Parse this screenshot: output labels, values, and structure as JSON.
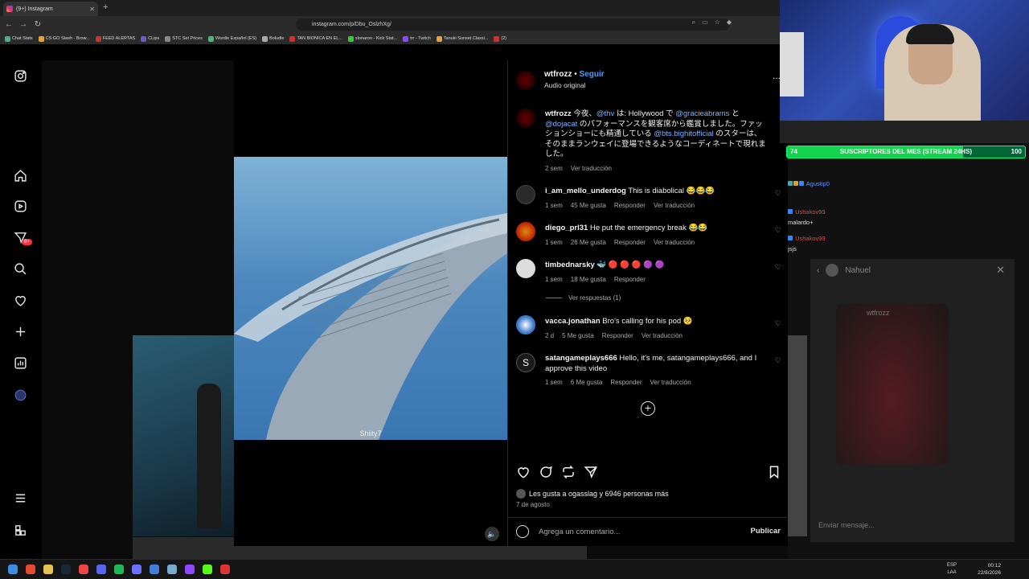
{
  "browser": {
    "tab_title": "(9+) Instagram",
    "url": "instagram.com/p/Dbu_OslzhXg/",
    "bookmarks": [
      "Chat Stats",
      "CS:GO Stash - Brow...",
      "FEED ALERTAS",
      "CLips",
      "STC Set Prices",
      "Wordle Español (ES)",
      "Boludle",
      "TAN BIONICA EN EL...",
      "slonaron - Kick Stat...",
      "trr - Twitch",
      "Tanuki Sunset Classi...",
      "(2)"
    ]
  },
  "sidebar": {
    "icons": [
      "instagram-icon",
      "home-icon",
      "reels-icon",
      "messages-icon",
      "search-icon",
      "heart-icon",
      "create-icon",
      "stats-icon",
      "profile-icon",
      "menu-icon",
      "grid-icon"
    ],
    "badge": "9+"
  },
  "post": {
    "username": "wtfrozz",
    "separator": "•",
    "follow": "Seguir",
    "audio": "Audio original",
    "more": "...",
    "media_label": "Shiity7",
    "caption": {
      "username": "wtfrozz",
      "p1": "今夜、",
      "m1": "@thv",
      "p2": " は: Hollywood で ",
      "m2": "@gracieabrams",
      "p3": " と ",
      "m3": "@dojacat",
      "p4": " のパフォーマンスを観客席から鑑賞しました。ファッションショーにも精通している ",
      "m4": "@bts.bighitofficial",
      "p5": " のスターは、そのままランウェイに登場できるようなコーディネートで現れました。",
      "time": "2 sem",
      "translate": "Ver traducción"
    },
    "comments": [
      {
        "user": "i_am_mello_underdog",
        "text": "This is diabolical 😂😂😂",
        "time": "1 sem",
        "likes": "45 Me gusta",
        "reply": "Responder",
        "translate": "Ver traducción"
      },
      {
        "user": "diego_prl31",
        "text": "He put the emergency break 😂😂",
        "time": "1 sem",
        "likes": "26 Me gusta",
        "reply": "Responder",
        "translate": "Ver traducción"
      },
      {
        "user": "timbednarsky",
        "text": "🐳 🔴 🔴 🔴 🟣 🟣",
        "time": "1 sem",
        "likes": "18 Me gusta",
        "reply": "Responder",
        "translate": ""
      },
      {
        "user": "vacca.jonathan",
        "text": "Bro's calling for his pod 🥺",
        "time": "2 d",
        "likes": "5 Me gusta",
        "reply": "Responder",
        "translate": "Ver traducción"
      },
      {
        "user": "satangameplays666",
        "text": "Hello, it's me, satangameplays666, and I approve this video",
        "time": "1 sem",
        "likes": "6 Me gusta",
        "reply": "Responder",
        "translate": "Ver traducción"
      }
    ],
    "view_replies": "Ver respuestas (1)",
    "likes_text": "Les gusta a ogasslag y 6946 personas más",
    "date": "7 de agosto",
    "comment_placeholder": "Agrega un comentario...",
    "publish": "Publicar"
  },
  "stream": {
    "sub_left": "74",
    "sub_label": "SUSCRIPTORES DEL MES (STREAM 24HS)",
    "sub_right": "100",
    "sub_progress": 0.74,
    "chat": [
      {
        "user": "Agustip0",
        "text": ""
      },
      {
        "user": "Ushakov99",
        "text": "malardo+"
      },
      {
        "user": "Ushakov99",
        "text": "jsjs"
      }
    ],
    "dm_name": "Nahuel",
    "dm_card_name": "wtfrozz",
    "dm_placeholder": "Enviar mensaje..."
  },
  "taskbar": {
    "lang": "ESP",
    "lang2": "LAA",
    "time": "00:12",
    "date": "22/8/2026"
  },
  "colors": {
    "accent_blue": "#4a9df8",
    "mention": "#7eb3ff",
    "sub_green": "#14d14e"
  }
}
